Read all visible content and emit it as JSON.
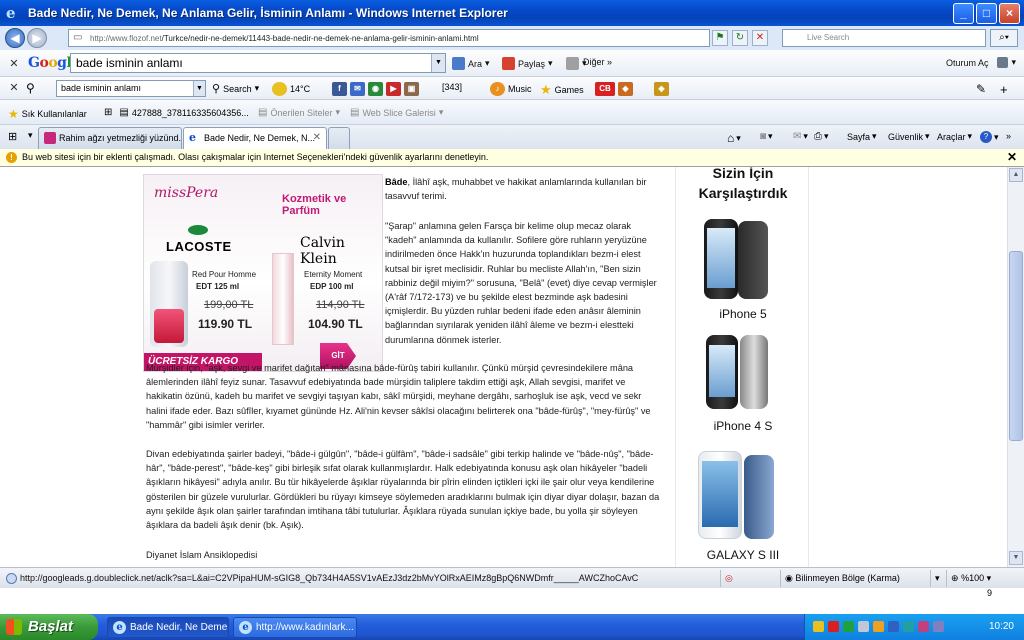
{
  "window": {
    "title": "Bade Nedir, Ne Demek, Ne Anlama Gelir, İsminin Anlamı - Windows Internet Explorer",
    "buttons": [
      "_",
      "□",
      "×"
    ]
  },
  "address_bar": {
    "url_host": "http://www.flozof.net",
    "url_path": "/Turkce/nedir-ne-demek/11443-bade-nedir-ne-demek-ne-anlama-gelir-isminin-anlami.html",
    "search_placeholder": "Live Search",
    "go_icon": "⌕▾"
  },
  "google_toolbar": {
    "logo": {
      "G": "G",
      "o1": "o",
      "o2": "o",
      "g": "g",
      "l": "l",
      "e": "e"
    },
    "search_value": "bade isminin anlamı",
    "ara": "Ara",
    "paylas": "Paylaş",
    "diger": "Diğer »",
    "oturum": "Oturum Aç"
  },
  "toolbar2": {
    "search_value": "bade isminin anlamı",
    "search_label": "Search",
    "temperature": "14°C",
    "count": "[343]",
    "music": "Music",
    "games": "Games"
  },
  "favorites_bar": {
    "favorites": "Sık Kullanılanlar",
    "item1": "427888_378116335604356...",
    "item2": "Önerilen Siteler",
    "item3": "Web Slice Galerisi"
  },
  "tabs": [
    {
      "label": "Rahim ağzı yetmezliği yüzünd..."
    },
    {
      "label": "Bade Nedir, Ne Demek, N..."
    }
  ],
  "tab_tools": {
    "sayfa": "Sayfa",
    "guvenlik": "Güvenlik",
    "araclar": "Araçlar"
  },
  "infobar": {
    "text": "Bu web sitesi için bir eklenti çalışmadı. Olası çakışmalar için Internet Seçenekleri'ndeki güvenlik ayarlarını denetleyin."
  },
  "ad": {
    "brand": "missPera",
    "tagline": "Kozmetik ve Parfüm",
    "brand1": "LACOSTE",
    "brand2": "Calvin Klein",
    "product1_name": "Red Pour Homme",
    "product1_size": "EDT 125 ml",
    "product1_old_price": "199,00 TL",
    "product1_price": "119.90 TL",
    "product2_name": "Eternity Moment",
    "product2_size": "EDP 100 ml",
    "product2_old_price": "114,90 TL",
    "product2_price": "104.90 TL",
    "free_shipping": "ÜCRETSİZ KARGO",
    "cta": "GİT"
  },
  "article": {
    "p1_bold": "Bâde",
    "p1_rest": ", İlâhî aşk, muhabbet ve hakikat anlamlarında kullanılan bir tasavvuf terimi.",
    "p2": "\"Şarap\" anlamına gelen Farsça bir kelime olup mecaz olarak \"kadeh\" anlamında da kullanılır. Sofilere göre ruhların yeryüzüne indirilmeden önce Hakk'ın huzurunda toplandıkları bezm-i elest kutsal bir işret meclisidir. Ruhlar bu mecliste Allah'ın, \"Ben sizin rabbiniz değil miyim?\" sorusuna, \"Belâ\" (evet) diye cevap vermişler (A'râf 7/172-173) ve bu şekilde elest bezminde aşk badesini içmişlerdir. Bu yüzden ruhlar bedeni ifade eden anâsır âleminin bağlarından sıyrılarak yeniden ilâhî âleme ve bezm-i elestteki durumlarına dönmek isterler.",
    "p3": "Mürşidler için, \"aşk, sevgi ve marifet dağıtan\" mânasına bâde-fürûş tabiri kullanılır. Çünkü mürşid çevresindekilere mâna âlemlerinden ilâhî feyiz sunar. Tasavvuf edebiyatında bade mürşidin taliplere takdim ettiği aşk, Allah sevgisi, marifet ve hakikatin özünü, kadeh bu marifet ve sevgiyi taşıyan kabı, sâkî mürşidi, meyhane dergâhı, sarhoşluk ise aşk, vecd ve sekr halini ifade eder. Bazı sûfîler, kıyamet gününde Hz. Ali'nin kevser sâkîsi olacağını belirterek ona \"bâde-fürûş\", \"mey-fürûş\" ve \"hammâr\" gibi isimler verirler.",
    "p4": "Divan edebiyatında şairler badeyi, \"bâde-i gülgûn\", \"bâde-i gülfâm\", \"bâde-i sadsâle\" gibi terkip halinde ve \"bâde-nûş\", \"bâde-hâr\", \"bâde-perest\", \"bâde-keş\" gibi birleşik sıfat olarak kullanmışlardır. Halk edebiyatında konusu aşk olan hikâyeler \"badeli âşıkların hikâyesi\" adıyla anılır. Bu tür hikâyelerde âşıklar rüyalarında bir pîrin elinden içtikleri içki ile şair olur veya kendilerine gösterilen bir güzele vurulurlar. Gördükleri bu rüyayı kimseye söylemeden aradıklarını bulmak için diyar diyar dolaşır, bazan da aynı şekilde âşık olan şairler tarafından imtihana tâbi tutulurlar. Âşıklara rüyada sunulan içkiye bade, bu yolla şir söyleyen âşıklara da badeli âşık denir (bk. Aşık).",
    "p5": "Diyanet İslam Ansiklopedisi"
  },
  "sidebar": {
    "heading1": "Sizin İçin",
    "heading2": "Karşılaştırdık",
    "phones": [
      {
        "label": "iPhone 5"
      },
      {
        "label": "iPhone 4 S"
      },
      {
        "label": "GALAXY S III"
      }
    ]
  },
  "status_bar": {
    "url": "http://googleads.g.doubleclick.net/aclk?sa=L&ai=C2VPipaHUM-sGIG8_Qb734H4A5SV1vAEzJ3dz2bMvYOlRxAEIMz8gBpQ6NWDmfr_____AWCZhoCAvC",
    "zone": "Bilinmeyen Bölge (Karma)",
    "zoom": "%100"
  },
  "below_status": {
    "number": "9"
  },
  "taskbar": {
    "start": "Başlat",
    "tasks": [
      {
        "label": "Bade Nedir, Ne Deme..."
      },
      {
        "label": "http://www.kadınlark..."
      }
    ],
    "clock": "10:20"
  },
  "colors": {
    "title_blue": "#0548c8",
    "taskbar_blue": "#245edb",
    "start_green": "#3a9a3a",
    "ad_magenta": "#c41468"
  }
}
